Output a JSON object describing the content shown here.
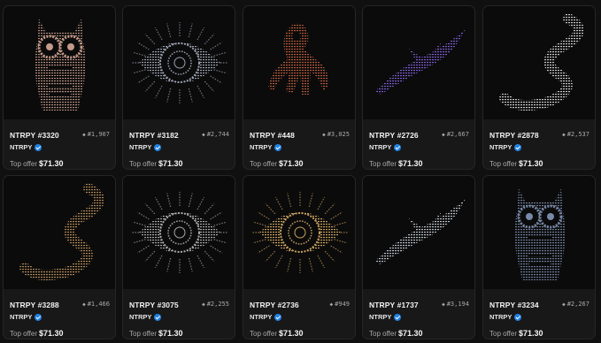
{
  "cards": [
    {
      "name": "NTRPY #3320",
      "rank": "#1,907",
      "collection": "NTRPY",
      "offer_label": "Top offer",
      "offer_price": "$71.30",
      "art": "owl"
    },
    {
      "name": "NTRPY #3182",
      "rank": "#2,744",
      "collection": "NTRPY",
      "offer_label": "Top offer",
      "offer_price": "$71.30",
      "art": "eye"
    },
    {
      "name": "NTRPY #448",
      "rank": "#3,025",
      "collection": "NTRPY",
      "offer_label": "Top offer",
      "offer_price": "$71.30",
      "art": "hands"
    },
    {
      "name": "NTRPY #2726",
      "rank": "#2,667",
      "collection": "NTRPY",
      "offer_label": "Top offer",
      "offer_price": "$71.30",
      "art": "fish"
    },
    {
      "name": "NTRPY #2878",
      "rank": "#2,537",
      "collection": "NTRPY",
      "offer_label": "Top offer",
      "offer_price": "$71.30",
      "art": "snake"
    },
    {
      "name": "NTRPY #3288",
      "rank": "#1,466",
      "collection": "NTRPY",
      "offer_label": "Top offer",
      "offer_price": "$71.30",
      "art": "snake"
    },
    {
      "name": "NTRPY #3075",
      "rank": "#2,255",
      "collection": "NTRPY",
      "offer_label": "Top offer",
      "offer_price": "$71.30",
      "art": "eye"
    },
    {
      "name": "NTRPY #2736",
      "rank": "#949",
      "collection": "NTRPY",
      "offer_label": "Top offer",
      "offer_price": "$71.30",
      "art": "eye"
    },
    {
      "name": "NTRPY #1737",
      "rank": "#3,194",
      "collection": "NTRPY",
      "offer_label": "Top offer",
      "offer_price": "$71.30",
      "art": "fish"
    },
    {
      "name": "NTRPY #3234",
      "rank": "#2,267",
      "collection": "NTRPY",
      "offer_label": "Top offer",
      "offer_price": "$71.30",
      "art": "owl"
    }
  ],
  "colors": {
    "page_bg": "#101010",
    "card_bg": "#181818",
    "verified_badge": "#2081e2",
    "art_tints": [
      "#c49a8a",
      "#9aa0b0",
      "#b45a3c",
      "#7a5ad0",
      "#c8c8c8",
      "#b08858",
      "#a8a8a8",
      "#c8a060",
      "#b8c0c8",
      "#7888a8"
    ]
  },
  "icons": {
    "rank": "diamond-icon",
    "verified": "verified-check-icon"
  }
}
